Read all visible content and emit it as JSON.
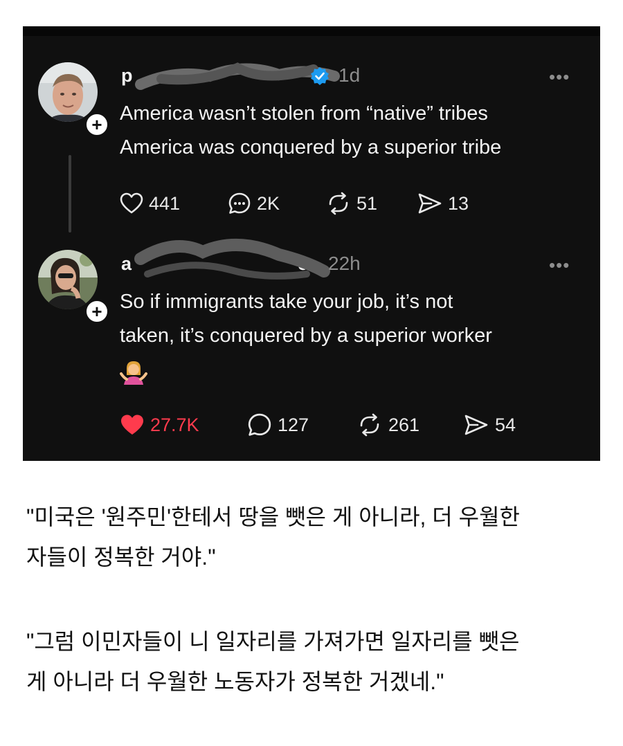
{
  "post1": {
    "username_visible_start": "p",
    "username_visible_end": "",
    "time": "1d",
    "text_lines": [
      "America wasn’t stolen from “native” tribes",
      "America was conquered by a superior tribe"
    ],
    "stats": {
      "likes": "441",
      "replies": "2K",
      "reposts": "51",
      "shares": "13"
    }
  },
  "post2": {
    "username_visible_start": "a",
    "username_visible_end": "es",
    "time": "22h",
    "text_lines": [
      "So if immigrants take your job, it’s not",
      "taken, it’s conquered by a superior worker"
    ],
    "emoji": "person-shrugging-emoji",
    "stats": {
      "likes": "27.7K",
      "replies": "127",
      "reposts": "261",
      "shares": "54"
    }
  },
  "caption": {
    "quote1_lines": [
      "\"미국은 '원주민'한테서 땅을 뺏은 게 아니라, 더 우월한",
      "자들이 정복한 거야.\""
    ],
    "quote2_lines": [
      "\"그럼 이민자들이 니 일자리를 가져가면 일자리를 뺏은",
      "게 아니라 더 우월한 노동자가 정복한 거겠네.\""
    ]
  },
  "colors": {
    "background": "#101010",
    "like_active": "#ff3b4d",
    "verified": "#1d9bf0",
    "muted": "#8d8d8d"
  },
  "icons": [
    "plus-icon",
    "verified-badge-icon",
    "more-icon",
    "heart-icon",
    "reply-bubble-icon",
    "repost-icon",
    "share-icon"
  ]
}
